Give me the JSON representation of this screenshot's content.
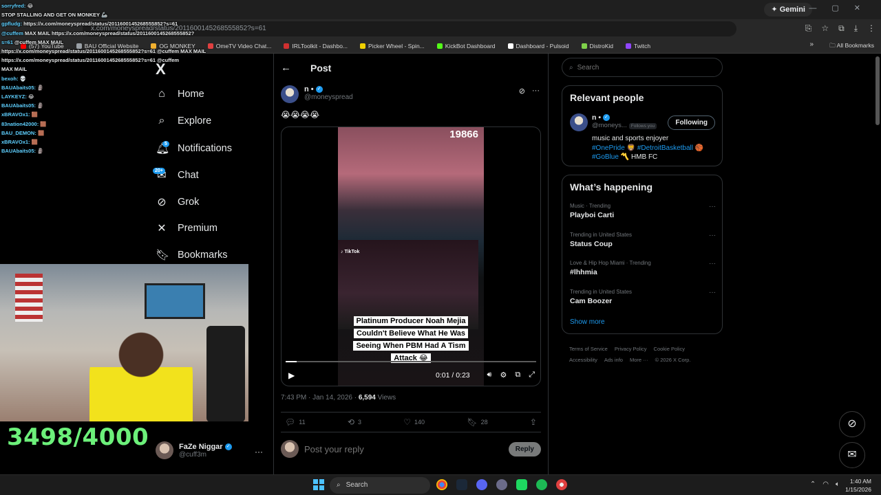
{
  "browser": {
    "gemini_label": "Gemini",
    "url": "x.com/moneyspread/status/2011600145268555852?s=61",
    "bookmarks": [
      {
        "label": "(57) YouTube",
        "color": "#ff0000"
      },
      {
        "label": "BAU Official Website",
        "color": "#9aa0a6"
      },
      {
        "label": "OG MONKEY",
        "color": "#f0b030"
      },
      {
        "label": "OmeTV Video Chat...",
        "color": "#e04040"
      },
      {
        "label": "IRLToolkit - Dashbo...",
        "color": "#d03030"
      },
      {
        "label": "Picker Wheel - Spin...",
        "color": "#f0d000"
      },
      {
        "label": "KickBot Dashboard",
        "color": "#53fc18"
      },
      {
        "label": "Dashboard - Pulsoid",
        "color": "#ffffff"
      },
      {
        "label": "DistroKid",
        "color": "#7fd14a"
      },
      {
        "label": "Twitch",
        "color": "#9146ff"
      }
    ],
    "bookmarks_overflow": "»",
    "all_bookmarks": "All Bookmarks"
  },
  "nav": {
    "logo": "X",
    "items": [
      {
        "label": "Home",
        "icon": "⌂"
      },
      {
        "label": "Explore",
        "icon": "⌕"
      },
      {
        "label": "Notifications",
        "icon": "🔔︎"
      },
      {
        "label": "Chat",
        "icon": "✉"
      },
      {
        "label": "Grok",
        "icon": "⊘"
      },
      {
        "label": "Premium",
        "icon": "✕"
      },
      {
        "label": "Bookmarks",
        "icon": "🔖︎"
      }
    ],
    "notifications_badge": "5",
    "chat_badge": "20+",
    "profile": {
      "name": "FaZe Niggar",
      "handle": "@cuff3m",
      "more": "···"
    }
  },
  "post": {
    "back": "←",
    "title": "Post",
    "author_name": "n •",
    "author_handle": "@moneyspread",
    "text": "😭😭😭😭",
    "video": {
      "counter": "19866",
      "tiktok_label": "TikTok",
      "caption": "Platinum Producer Noah Mejia Couldn't Believe What He Was Seeing When PBM Had A Tism Attack 😂",
      "time": "0:01 / 0:23",
      "progress": 0.043
    },
    "time": "7:43 PM · Jan 14, 2026 · ",
    "views_count": "6,594",
    "views_label": " Views",
    "engagement": {
      "replies": "11",
      "reposts": "3",
      "likes": "140",
      "bookmarks": "28"
    },
    "reply_placeholder": "Post your reply",
    "reply_button": "Reply"
  },
  "sidebar": {
    "search_placeholder": "Search",
    "relevant_title": "Relevant people",
    "relevant_user": {
      "name": "n •",
      "handle": "@moneys...",
      "follows_you": "Follows you",
      "button": "Following",
      "bio_text": "music and sports enjoyer",
      "tags_line1_a": "#OnePride",
      "tags_line1_b": "#DetroitBasketball",
      "tags_line2_a": "#GoBlue",
      "tags_line2_b": "HMB FC"
    },
    "happening_title": "What’s happening",
    "trends": [
      {
        "context": "Music · Trending",
        "name": "Playboi Carti"
      },
      {
        "context": "Trending in United States",
        "name": "Status Coup"
      },
      {
        "context": "Love & Hip Hop Miami · Trending",
        "name": "#lhhmia"
      },
      {
        "context": "Trending in United States",
        "name": "Cam Boozer"
      }
    ],
    "show_more": "Show more",
    "footer": [
      "Terms of Service",
      "Privacy Policy",
      "Cookie Policy",
      "Accessibility",
      "Ads info",
      "More ···",
      "© 2026 X Corp."
    ]
  },
  "overlay": {
    "chat": [
      {
        "user": "sorryfred:",
        "msg": "😂"
      },
      {
        "user": "",
        "msg": "STOP STALLING AND GET ON MONKEY 🦾"
      },
      {
        "user": "",
        "msg": ""
      },
      {
        "user": "gpfludg:",
        "msg": "https://x.com/moneyspread/status/2011600145268555852?s=61"
      },
      {
        "user": "@cuffem",
        "msg": "MAX MAIL https://x.com/moneyspread/status/2011600145268555852?"
      },
      {
        "user": "s=61",
        "msg": "@cuffem MAX MAIL"
      },
      {
        "user": "",
        "msg": "https://x.com/moneyspread/status/2011600145268555852?s=61 @cuffem MAX MAIL https://x.com/moneyspread/status/2011600145268555852?s=61 @cuffem"
      },
      {
        "user": "",
        "msg": "MAX MAIL"
      },
      {
        "user": "bexoh:",
        "msg": "💀"
      },
      {
        "user": "BAUAbaits05:",
        "msg": "🗿"
      },
      {
        "user": "LAYKEYZ:",
        "msg": "😂"
      },
      {
        "user": "BAUAbaits05:",
        "msg": "🗿"
      },
      {
        "user": "xBRAVOx1:",
        "msg": "🟫"
      },
      {
        "user": "83nation42000:",
        "msg": "🟫"
      },
      {
        "user": "BAU_DEMON:",
        "msg": "🟫"
      },
      {
        "user": "xBRAVOx1:",
        "msg": "🟫"
      },
      {
        "user": "BAUAbaits05:",
        "msg": "🗿"
      }
    ],
    "goal": "3498/4000"
  },
  "taskbar": {
    "search": "Search",
    "time": "1:40 AM",
    "date": "1/15/2026"
  }
}
